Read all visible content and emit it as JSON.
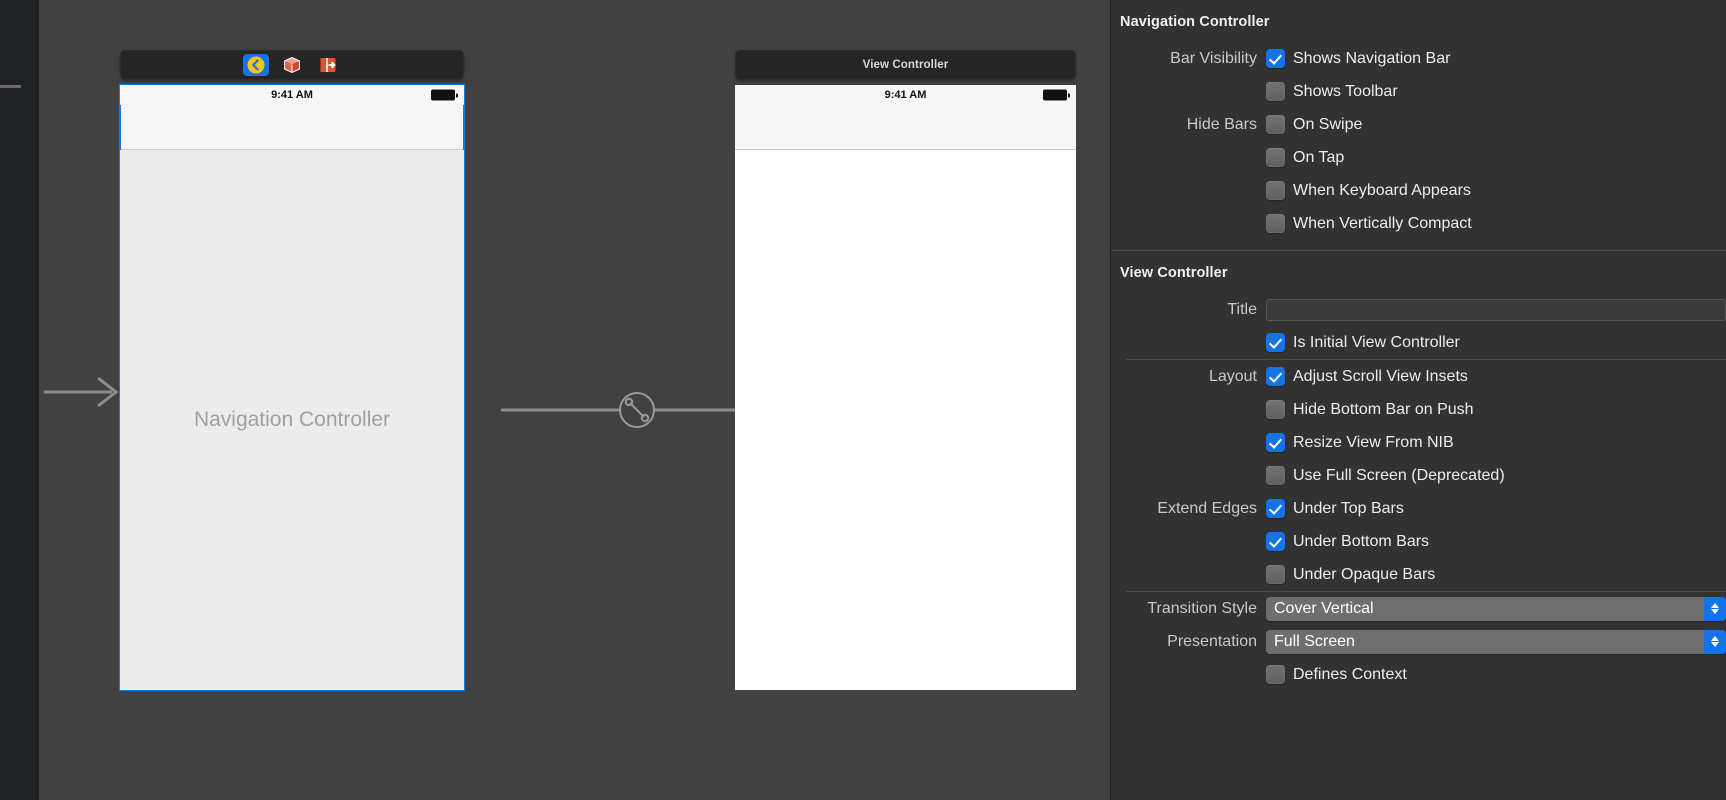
{
  "canvas": {
    "nav_scene": {
      "dock_icons": [
        {
          "name": "back-chevron-icon",
          "selected": true
        },
        {
          "name": "first-responder-cube-icon",
          "selected": false
        },
        {
          "name": "exit-segue-icon",
          "selected": false
        }
      ],
      "status_time": "9:41 AM",
      "placeholder": "Navigation Controller"
    },
    "vc_scene": {
      "dock_title": "View Controller",
      "status_time": "9:41 AM"
    },
    "segue": {
      "icon": "relationship-segue-icon"
    },
    "entry_arrow": {
      "icon": "initial-view-controller-arrow"
    }
  },
  "inspector": {
    "nav_section": {
      "title": "Navigation Controller",
      "rows": [
        {
          "label": "Bar Visibility",
          "text": "Shows Navigation Bar",
          "checked": true
        },
        {
          "label": "",
          "text": "Shows Toolbar",
          "checked": false
        },
        {
          "label": "Hide Bars",
          "text": "On Swipe",
          "checked": false
        },
        {
          "label": "",
          "text": "On Tap",
          "checked": false
        },
        {
          "label": "",
          "text": "When Keyboard Appears",
          "checked": false
        },
        {
          "label": "",
          "text": "When Vertically Compact",
          "checked": false
        }
      ]
    },
    "vc_section": {
      "title": "View Controller",
      "title_field": {
        "label": "Title",
        "value": "",
        "placeholder": ""
      },
      "initial": {
        "label": "",
        "text": "Is Initial View Controller",
        "checked": true
      },
      "layout_rows": [
        {
          "label": "Layout",
          "text": "Adjust Scroll View Insets",
          "checked": true
        },
        {
          "label": "",
          "text": "Hide Bottom Bar on Push",
          "checked": false
        },
        {
          "label": "",
          "text": "Resize View From NIB",
          "checked": true
        },
        {
          "label": "",
          "text": "Use Full Screen (Deprecated)",
          "checked": false
        },
        {
          "label": "Extend Edges",
          "text": "Under Top Bars",
          "checked": true
        },
        {
          "label": "",
          "text": "Under Bottom Bars",
          "checked": true
        },
        {
          "label": "",
          "text": "Under Opaque Bars",
          "checked": false
        }
      ],
      "transition_style": {
        "label": "Transition Style",
        "value": "Cover Vertical"
      },
      "presentation": {
        "label": "Presentation",
        "value": "Full Screen"
      },
      "defines_context": {
        "label": "",
        "text": "Defines Context",
        "checked": false
      }
    }
  },
  "colors": {
    "accent_blue": "#1473e6",
    "panel_bg": "#323232",
    "canvas_bg": "#414141",
    "rail_bg": "#202124"
  }
}
